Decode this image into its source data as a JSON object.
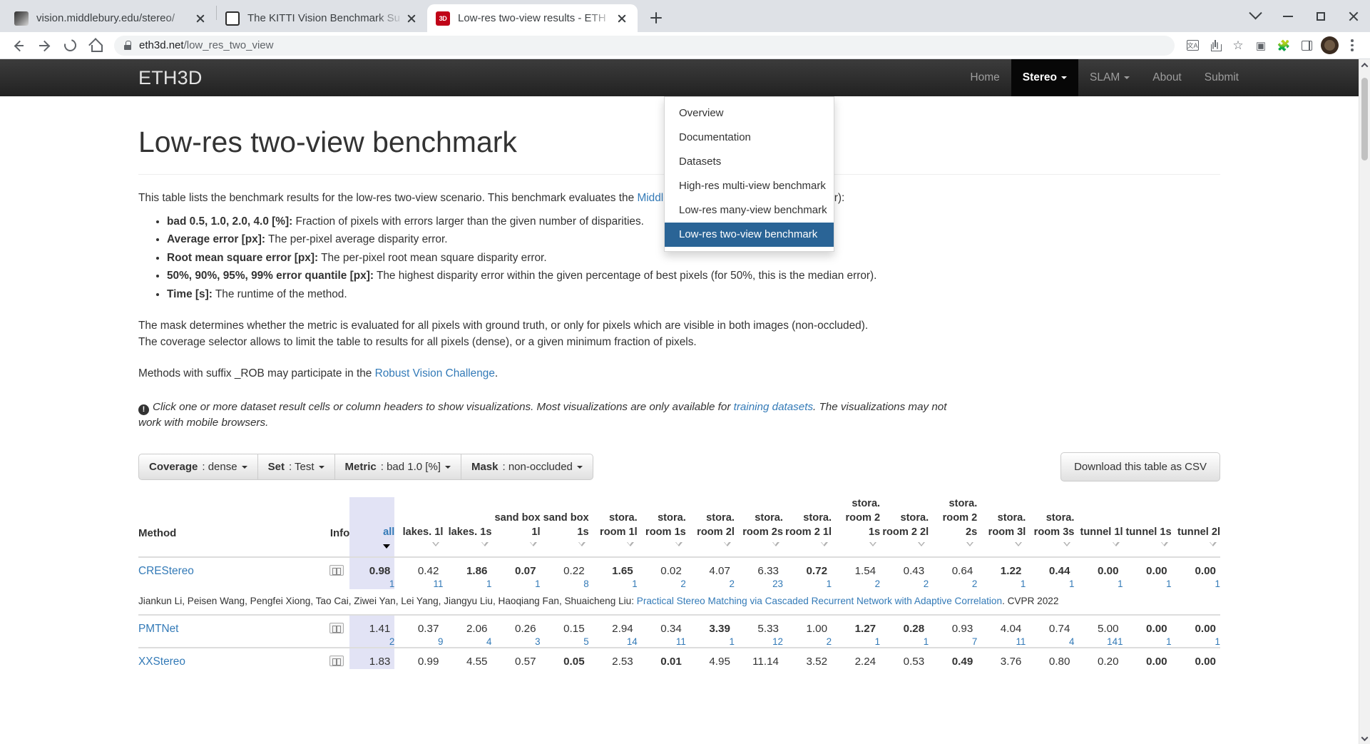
{
  "browser": {
    "tabs": [
      {
        "title": "vision.middlebury.edu/stereo/",
        "favicon": "middlebury-icon",
        "active": false
      },
      {
        "title": "The KITTI Vision Benchmark Su",
        "favicon": "kitti-icon",
        "active": false
      },
      {
        "title": "Low-res two-view results - ETH",
        "favicon": "eth3d-icon",
        "active": true
      }
    ],
    "new_tab_label": "+",
    "url_host": "eth3d.net",
    "url_path": "/low_res_two_view",
    "window_controls": [
      "chevron-down",
      "minimize",
      "maximize",
      "close"
    ]
  },
  "site": {
    "brand": "ETH3D",
    "nav": [
      {
        "label": "Home",
        "caret": false,
        "active": false
      },
      {
        "label": "Stereo",
        "caret": true,
        "active": true
      },
      {
        "label": "SLAM",
        "caret": true,
        "active": false
      },
      {
        "label": "About",
        "caret": false,
        "active": false
      },
      {
        "label": "Submit",
        "caret": false,
        "active": false
      }
    ],
    "dropdown": [
      {
        "label": "Overview",
        "selected": false
      },
      {
        "label": "Documentation",
        "selected": false
      },
      {
        "label": "Datasets",
        "selected": false
      },
      {
        "label": "High-res multi-view benchmark",
        "selected": false
      },
      {
        "label": "Low-res many-view benchmark",
        "selected": false
      },
      {
        "label": "Low-res two-view benchmark",
        "selected": true
      }
    ]
  },
  "page": {
    "title": "Low-res two-view benchmark",
    "intro_a": "This table lists the benchmark results for the low-res two-view scenario. This benchmark evaluates the ",
    "intro_link": "Middlebury stereo metrics",
    "intro_b": " (lower is better):",
    "metrics": [
      {
        "term": "bad 0.5, 1.0, 2.0, 4.0 [%]:",
        "desc": " Fraction of pixels with errors larger than the given number of disparities."
      },
      {
        "term": "Average error [px]:",
        "desc": " The per-pixel average disparity error."
      },
      {
        "term": "Root mean square error [px]:",
        "desc": " The per-pixel root mean square disparity error."
      },
      {
        "term": "50%, 90%, 95%, 99% error quantile [px]:",
        "desc": " The highest disparity error within the given percentage of best pixels (for 50%, this is the median error)."
      },
      {
        "term": "Time [s]:",
        "desc": " The runtime of the method."
      }
    ],
    "mask_line": "The mask determines whether the metric is evaluated for all pixels with ground truth, or only for pixels which are visible in both images (non-occluded).",
    "coverage_line": "The coverage selector allows to limit the table to results for all pixels (dense), or a given minimum fraction of pixels.",
    "rob_a": "Methods with suffix _ROB may participate in the ",
    "rob_link": "Robust Vision Challenge",
    "rob_b": ".",
    "note_a": "Click one or more dataset result cells or column headers to show visualizations. Most visualizations are only available for ",
    "note_link": "training datasets",
    "note_b": ". The visualizations may not work with mobile browsers."
  },
  "filters": [
    {
      "label": "Coverage",
      "value": "dense"
    },
    {
      "label": "Set",
      "value": "Test"
    },
    {
      "label": "Metric",
      "value": "bad 1.0 [%]"
    },
    {
      "label": "Mask",
      "value": "non-occluded"
    }
  ],
  "download_label": "Download this table as CSV",
  "table": {
    "method_header": "Method",
    "info_header": "Info",
    "columns": [
      {
        "label": "all",
        "highlight": true,
        "sorted": true
      },
      {
        "label": "lakes. 1l",
        "highlight": false,
        "sorted": false
      },
      {
        "label": "lakes. 1s",
        "highlight": false,
        "sorted": false
      },
      {
        "label": "sand box 1l",
        "highlight": false,
        "sorted": false
      },
      {
        "label": "sand box 1s",
        "highlight": false,
        "sorted": false
      },
      {
        "label": "stora. room 1l",
        "highlight": false,
        "sorted": false
      },
      {
        "label": "stora. room 1s",
        "highlight": false,
        "sorted": false
      },
      {
        "label": "stora. room 2l",
        "highlight": false,
        "sorted": false
      },
      {
        "label": "stora. room 2s",
        "highlight": false,
        "sorted": false
      },
      {
        "label": "stora. room 2 1l",
        "highlight": false,
        "sorted": false
      },
      {
        "label": "stora. room 2 1s",
        "highlight": false,
        "sorted": false
      },
      {
        "label": "stora. room 2 2l",
        "highlight": false,
        "sorted": false
      },
      {
        "label": "stora. room 2 2s",
        "highlight": false,
        "sorted": false
      },
      {
        "label": "stora. room 3l",
        "highlight": false,
        "sorted": false
      },
      {
        "label": "stora. room 3s",
        "highlight": false,
        "sorted": false
      },
      {
        "label": "tunnel 1l",
        "highlight": false,
        "sorted": false
      },
      {
        "label": "tunnel 1s",
        "highlight": false,
        "sorted": false
      },
      {
        "label": "tunnel 2l",
        "highlight": false,
        "sorted": false
      }
    ],
    "rows": [
      {
        "method": "CREStereo",
        "values": [
          "0.98",
          "0.42",
          "1.86",
          "0.07",
          "0.22",
          "1.65",
          "0.02",
          "4.07",
          "6.33",
          "0.72",
          "1.54",
          "0.43",
          "0.64",
          "1.22",
          "0.44",
          "0.00",
          "0.00",
          "0.00"
        ],
        "bold": [
          true,
          false,
          true,
          true,
          false,
          true,
          false,
          false,
          false,
          true,
          false,
          false,
          false,
          true,
          true,
          true,
          true,
          true
        ],
        "ranks": [
          "1",
          "11",
          "1",
          "1",
          "8",
          "1",
          "2",
          "2",
          "23",
          "1",
          "2",
          "2",
          "2",
          "1",
          "1",
          "1",
          "1",
          "1"
        ],
        "citation_authors": "Jiankun Li, Peisen Wang, Pengfei Xiong, Tao Cai, Ziwei Yan, Lei Yang, Jiangyu Liu, Haoqiang Fan, Shuaicheng Liu: ",
        "citation_link": "Practical Stereo Matching via Cascaded Recurrent Network with Adaptive Correlation",
        "citation_venue": ". CVPR 2022"
      },
      {
        "method": "PMTNet",
        "values": [
          "1.41",
          "0.37",
          "2.06",
          "0.26",
          "0.15",
          "2.94",
          "0.34",
          "3.39",
          "5.33",
          "1.00",
          "1.27",
          "0.28",
          "0.93",
          "4.04",
          "0.74",
          "5.00",
          "0.00",
          "0.00"
        ],
        "bold": [
          false,
          false,
          false,
          false,
          false,
          false,
          false,
          true,
          false,
          false,
          true,
          true,
          false,
          false,
          false,
          false,
          true,
          true
        ],
        "ranks": [
          "2",
          "9",
          "4",
          "3",
          "5",
          "14",
          "11",
          "1",
          "12",
          "2",
          "1",
          "1",
          "7",
          "11",
          "4",
          "141",
          "1",
          "1"
        ],
        "citation_authors": "",
        "citation_link": "",
        "citation_venue": ""
      },
      {
        "method": "XXStereo",
        "values": [
          "1.83",
          "0.99",
          "4.55",
          "0.57",
          "0.05",
          "2.53",
          "0.01",
          "4.95",
          "11.14",
          "3.52",
          "2.24",
          "0.53",
          "0.49",
          "3.76",
          "0.80",
          "0.20",
          "0.00",
          "0.00"
        ],
        "bold": [
          false,
          false,
          false,
          false,
          true,
          false,
          true,
          false,
          false,
          false,
          false,
          false,
          true,
          false,
          false,
          false,
          true,
          true
        ],
        "ranks": [
          "",
          "",
          "",
          "",
          "",
          "",
          "",
          "",
          "",
          "",
          "",
          "",
          "",
          "",
          "",
          "",
          "",
          ""
        ],
        "citation_authors": "",
        "citation_link": "",
        "citation_venue": ""
      }
    ]
  }
}
